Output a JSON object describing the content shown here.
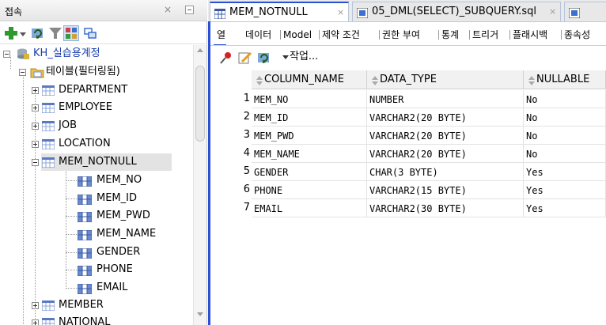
{
  "connections": {
    "title": "접속",
    "close_label": "×"
  },
  "tree": {
    "connection": "KH_실습용계정",
    "tables_folder": "테이블(필터링됨)",
    "tables": [
      "DEPARTMENT",
      "EMPLOYEE",
      "JOB",
      "LOCATION",
      "MEM_NOTNULL"
    ],
    "columns": [
      "MEM_NO",
      "MEM_ID",
      "MEM_PWD",
      "MEM_NAME",
      "GENDER",
      "PHONE",
      "EMAIL"
    ],
    "tables_after": [
      "MEMBER",
      "NATIONAL"
    ]
  },
  "editor_tabs": [
    {
      "label": "MEM_NOTNULL",
      "close": "×"
    },
    {
      "label": "05_DML(SELECT)_SUBQUERY.sql",
      "close": "×"
    },
    {
      "label": "",
      "close": ""
    }
  ],
  "subtabs": [
    "열",
    "데이터",
    "Model",
    "제약 조건",
    "권한 부여",
    "통계",
    "트리거",
    "플래시백",
    "종속성"
  ],
  "toolbar": {
    "work_label": "작업..."
  },
  "grid": {
    "headers": [
      "COLUMN_NAME",
      "DATA_TYPE",
      "NULLABLE"
    ],
    "rows": [
      {
        "num": "1",
        "name": "MEM_NO",
        "type": "NUMBER",
        "nullable": "No"
      },
      {
        "num": "2",
        "name": "MEM_ID",
        "type": "VARCHAR2(20 BYTE)",
        "nullable": "No"
      },
      {
        "num": "3",
        "name": "MEM_PWD",
        "type": "VARCHAR2(20 BYTE)",
        "nullable": "No"
      },
      {
        "num": "4",
        "name": "MEM_NAME",
        "type": "VARCHAR2(20 BYTE)",
        "nullable": "No"
      },
      {
        "num": "5",
        "name": "GENDER",
        "type": "CHAR(3 BYTE)",
        "nullable": "Yes"
      },
      {
        "num": "6",
        "name": "PHONE",
        "type": "VARCHAR2(15 BYTE)",
        "nullable": "Yes"
      },
      {
        "num": "7",
        "name": "EMAIL",
        "type": "VARCHAR2(30 BYTE)",
        "nullable": "Yes"
      }
    ]
  },
  "colors": {
    "accent": "#2a4fd6",
    "selection": "#e3e3e3"
  }
}
